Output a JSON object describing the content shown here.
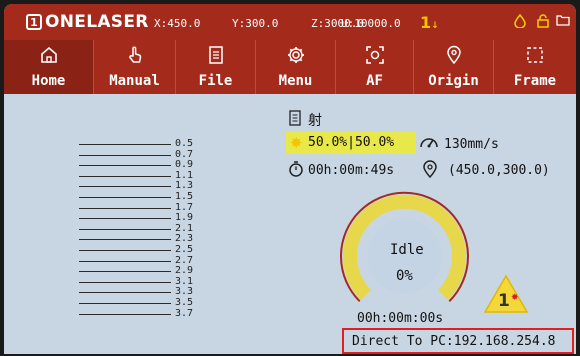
{
  "status": {
    "logo_box": "1",
    "logo_text": "ONELASER",
    "x": "X:450.0",
    "y": "Y:300.0",
    "z": "Z:3000.0",
    "u": "U:10000.0",
    "alarm_count": "1",
    "alarm_arrow": "↓"
  },
  "tabs": [
    {
      "label": "Home",
      "icon": "home-icon"
    },
    {
      "label": "Manual",
      "icon": "hand-icon"
    },
    {
      "label": "File",
      "icon": "document-icon"
    },
    {
      "label": "Menu",
      "icon": "gear-icon"
    },
    {
      "label": "AF",
      "icon": "focus-icon"
    },
    {
      "label": "Origin",
      "icon": "location-pin-icon"
    },
    {
      "label": "Frame",
      "icon": "frame-icon"
    }
  ],
  "active_tab": "Home",
  "ruler_labels": [
    "0.5",
    "0.7",
    "0.9",
    "1.1",
    "1.3",
    "1.5",
    "1.7",
    "1.9",
    "2.1",
    "2.3",
    "2.5",
    "2.7",
    "2.9",
    "3.1",
    "3.3",
    "3.5",
    "3.7"
  ],
  "job": {
    "file_name": "射",
    "power": "50.0%|50.0%",
    "speed": "130mm/s",
    "elapsed": "00h:00m:49s",
    "position": "(450.0,300.0)"
  },
  "progress": {
    "state": "Idle",
    "percent_text": "0%",
    "percent_value": 0,
    "remaining": "00h:00m:00s"
  },
  "warning_badge": "1",
  "connection": {
    "text": "Direct To PC:192.168.254.8"
  },
  "colors": {
    "header": "#a42a1c",
    "background": "#c8d6e3",
    "ring": "#e6d84a",
    "highlight": "#e8e84a",
    "ip_border": "#e02020"
  }
}
